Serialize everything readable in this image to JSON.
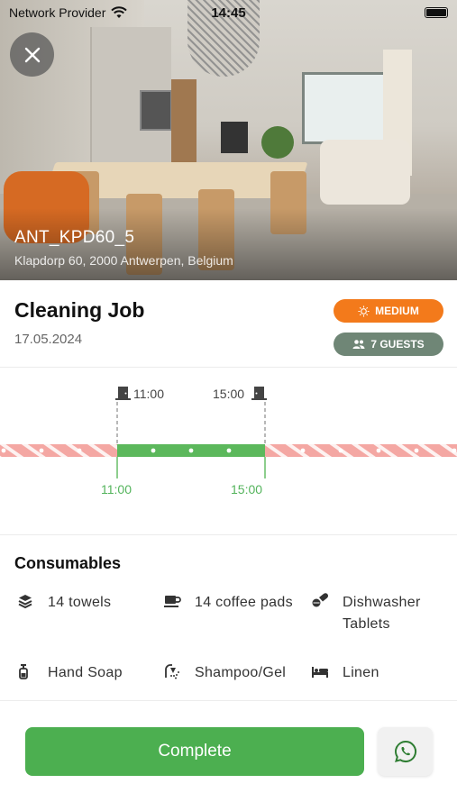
{
  "status_bar": {
    "carrier": "Network Provider",
    "time": "14:45"
  },
  "property": {
    "name": "ANT_KPD60_5",
    "address": "Klapdorp 60, 2000 Antwerpen, Belgium"
  },
  "job": {
    "title": "Cleaning Job",
    "date": "17.05.2024",
    "priority_label": "MEDIUM",
    "guests_label": "7 GUESTS"
  },
  "timeline": {
    "checkout_time": "11:00",
    "checkin_time": "15:00",
    "window_start": "11:00",
    "window_end": "15:00"
  },
  "consumables": {
    "title": "Consumables",
    "items": [
      {
        "icon": "layers-icon",
        "label": "14 towels"
      },
      {
        "icon": "coffee-icon",
        "label": "14 coffee pads"
      },
      {
        "icon": "tablets-icon",
        "label": "Dishwasher Tablets"
      },
      {
        "icon": "soap-dispenser-icon",
        "label": "Hand Soap"
      },
      {
        "icon": "shower-icon",
        "label": "Shampoo/Gel"
      },
      {
        "icon": "bed-icon",
        "label": "Linen"
      }
    ]
  },
  "actions": {
    "complete_label": "Complete",
    "whatsapp_icon": "whatsapp-icon"
  },
  "colors": {
    "priority": "#f37a1b",
    "guests": "#6f8676",
    "primary": "#4caf50",
    "occupied": "#f4a7a3"
  }
}
